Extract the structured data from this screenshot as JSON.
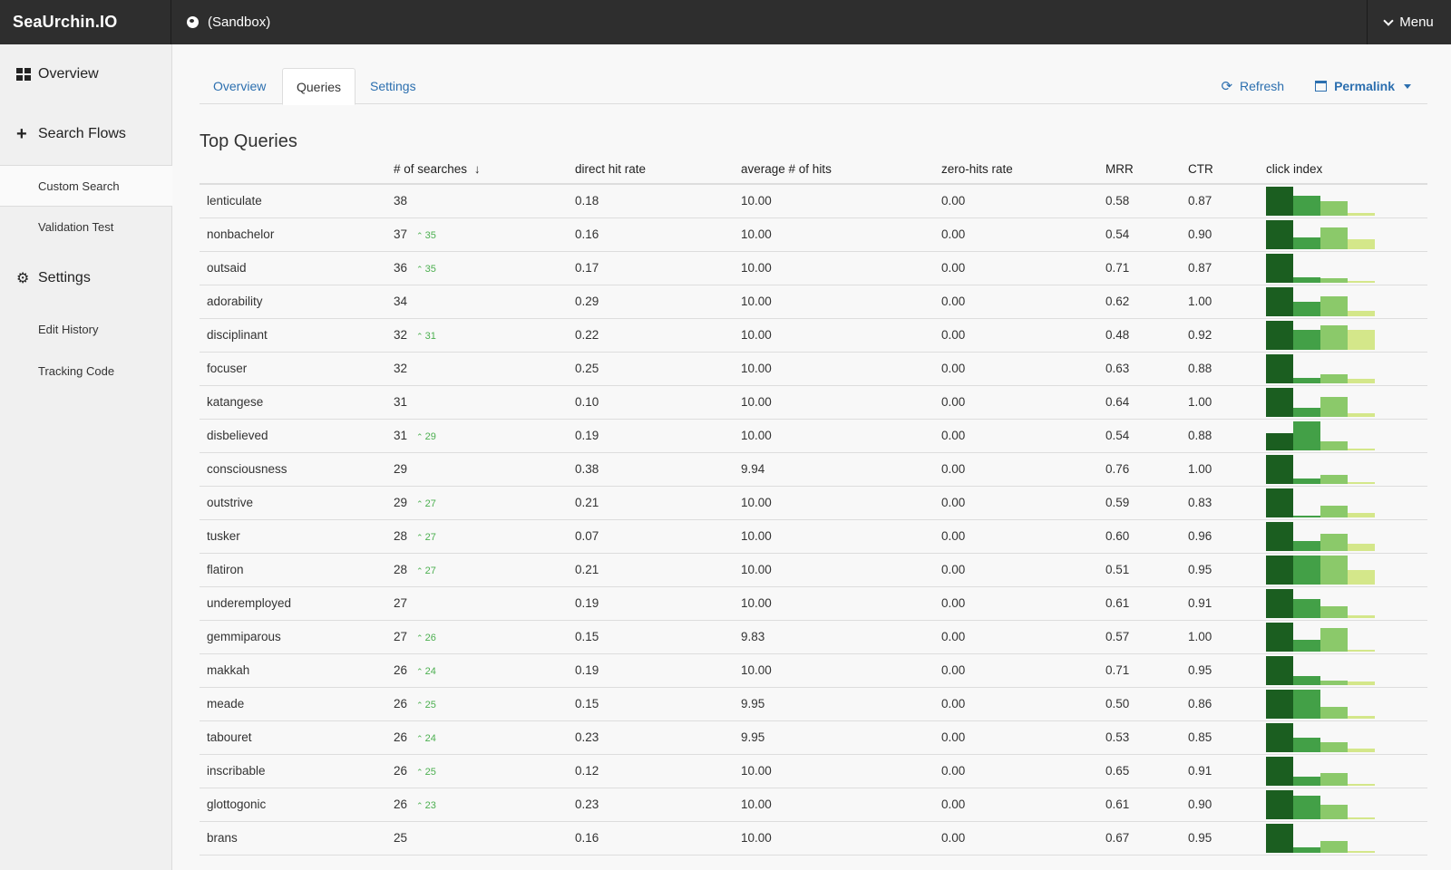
{
  "header": {
    "brand": "SeaUrchin.IO",
    "environment": "(Sandbox)",
    "menu_label": "Menu"
  },
  "sidebar": {
    "overview_label": "Overview",
    "search_flows_label": "Search Flows",
    "custom_search_label": "Custom Search",
    "validation_test_label": "Validation Test",
    "settings_label": "Settings",
    "edit_history_label": "Edit History",
    "tracking_code_label": "Tracking Code"
  },
  "tabs": {
    "overview": "Overview",
    "queries": "Queries",
    "settings": "Settings"
  },
  "tools": {
    "refresh": "Refresh",
    "permalink": "Permalink"
  },
  "section_title": "Top Queries",
  "columns": {
    "query": "",
    "searches": "# of searches",
    "sort_indicator": "↓",
    "direct_hit_rate": "direct hit rate",
    "avg_hits": "average # of hits",
    "zero_hits_rate": "zero-hits rate",
    "mrr": "MRR",
    "ctr": "CTR",
    "click_index": "click index"
  },
  "delta_arrow": "⌃",
  "rows": [
    {
      "query": "lenticulate",
      "searches": "38",
      "delta": "",
      "dhr": "0.18",
      "avg": "10.00",
      "zero": "0.00",
      "mrr": "0.58",
      "ctr": "0.87",
      "click": [
        1.0,
        0.7,
        0.5,
        0.1
      ]
    },
    {
      "query": "nonbachelor",
      "searches": "37",
      "delta": "35",
      "dhr": "0.16",
      "avg": "10.00",
      "zero": "0.00",
      "mrr": "0.54",
      "ctr": "0.90",
      "click": [
        1.0,
        0.4,
        0.75,
        0.35
      ]
    },
    {
      "query": "outsaid",
      "searches": "36",
      "delta": "35",
      "dhr": "0.17",
      "avg": "10.00",
      "zero": "0.00",
      "mrr": "0.71",
      "ctr": "0.87",
      "click": [
        1.0,
        0.2,
        0.15,
        0.05
      ]
    },
    {
      "query": "adorability",
      "searches": "34",
      "delta": "",
      "dhr": "0.29",
      "avg": "10.00",
      "zero": "0.00",
      "mrr": "0.62",
      "ctr": "1.00",
      "click": [
        1.0,
        0.5,
        0.7,
        0.2
      ]
    },
    {
      "query": "disciplinant",
      "searches": "32",
      "delta": "31",
      "dhr": "0.22",
      "avg": "10.00",
      "zero": "0.00",
      "mrr": "0.48",
      "ctr": "0.92",
      "click": [
        1.0,
        0.7,
        0.85,
        0.7
      ]
    },
    {
      "query": "focuser",
      "searches": "32",
      "delta": "",
      "dhr": "0.25",
      "avg": "10.00",
      "zero": "0.00",
      "mrr": "0.63",
      "ctr": "0.88",
      "click": [
        1.0,
        0.2,
        0.3,
        0.15
      ]
    },
    {
      "query": "katangese",
      "searches": "31",
      "delta": "",
      "dhr": "0.10",
      "avg": "10.00",
      "zero": "0.00",
      "mrr": "0.64",
      "ctr": "1.00",
      "click": [
        1.0,
        0.3,
        0.7,
        0.12
      ]
    },
    {
      "query": "disbelieved",
      "searches": "31",
      "delta": "29",
      "dhr": "0.19",
      "avg": "10.00",
      "zero": "0.00",
      "mrr": "0.54",
      "ctr": "0.88",
      "click": [
        0.6,
        1.0,
        0.3,
        0.05
      ]
    },
    {
      "query": "consciousness",
      "searches": "29",
      "delta": "",
      "dhr": "0.38",
      "avg": "9.94",
      "zero": "0.00",
      "mrr": "0.76",
      "ctr": "1.00",
      "click": [
        1.0,
        0.2,
        0.3,
        0.05
      ]
    },
    {
      "query": "outstrive",
      "searches": "29",
      "delta": "27",
      "dhr": "0.21",
      "avg": "10.00",
      "zero": "0.00",
      "mrr": "0.59",
      "ctr": "0.83",
      "click": [
        1.0,
        0.05,
        0.4,
        0.15
      ]
    },
    {
      "query": "tusker",
      "searches": "28",
      "delta": "27",
      "dhr": "0.07",
      "avg": "10.00",
      "zero": "0.00",
      "mrr": "0.60",
      "ctr": "0.96",
      "click": [
        1.0,
        0.35,
        0.6,
        0.25
      ]
    },
    {
      "query": "flatiron",
      "searches": "28",
      "delta": "27",
      "dhr": "0.21",
      "avg": "10.00",
      "zero": "0.00",
      "mrr": "0.51",
      "ctr": "0.95",
      "click": [
        1.0,
        1.0,
        1.0,
        0.5
      ]
    },
    {
      "query": "underemployed",
      "searches": "27",
      "delta": "",
      "dhr": "0.19",
      "avg": "10.00",
      "zero": "0.00",
      "mrr": "0.61",
      "ctr": "0.91",
      "click": [
        1.0,
        0.65,
        0.4,
        0.1
      ]
    },
    {
      "query": "gemmiparous",
      "searches": "27",
      "delta": "26",
      "dhr": "0.15",
      "avg": "9.83",
      "zero": "0.00",
      "mrr": "0.57",
      "ctr": "1.00",
      "click": [
        1.0,
        0.4,
        0.8,
        0.05
      ]
    },
    {
      "query": "makkah",
      "searches": "26",
      "delta": "24",
      "dhr": "0.19",
      "avg": "10.00",
      "zero": "0.00",
      "mrr": "0.71",
      "ctr": "0.95",
      "click": [
        1.0,
        0.3,
        0.15,
        0.12
      ]
    },
    {
      "query": "meade",
      "searches": "26",
      "delta": "25",
      "dhr": "0.15",
      "avg": "9.95",
      "zero": "0.00",
      "mrr": "0.50",
      "ctr": "0.86",
      "click": [
        1.0,
        1.0,
        0.4,
        0.1
      ]
    },
    {
      "query": "tabouret",
      "searches": "26",
      "delta": "24",
      "dhr": "0.23",
      "avg": "9.95",
      "zero": "0.00",
      "mrr": "0.53",
      "ctr": "0.85",
      "click": [
        1.0,
        0.5,
        0.35,
        0.12
      ]
    },
    {
      "query": "inscribable",
      "searches": "26",
      "delta": "25",
      "dhr": "0.12",
      "avg": "10.00",
      "zero": "0.00",
      "mrr": "0.65",
      "ctr": "0.91",
      "click": [
        1.0,
        0.3,
        0.45,
        0.05
      ]
    },
    {
      "query": "glottogonic",
      "searches": "26",
      "delta": "23",
      "dhr": "0.23",
      "avg": "10.00",
      "zero": "0.00",
      "mrr": "0.61",
      "ctr": "0.90",
      "click": [
        1.0,
        0.8,
        0.5,
        0.05
      ]
    },
    {
      "query": "brans",
      "searches": "25",
      "delta": "",
      "dhr": "0.16",
      "avg": "10.00",
      "zero": "0.00",
      "mrr": "0.67",
      "ctr": "0.95",
      "click": [
        1.0,
        0.2,
        0.4,
        0.05
      ]
    }
  ],
  "colors": {
    "click_1": "#1b5e20",
    "click_2": "#43a047",
    "click_3": "#8bc96a",
    "click_4": "#d4e78a",
    "link": "#2c6faf",
    "delta": "#4caf50"
  }
}
